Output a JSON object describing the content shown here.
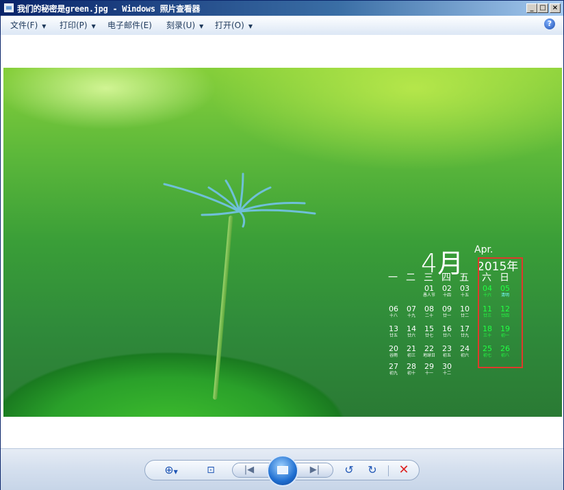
{
  "window": {
    "title": "我们的秘密是green.jpg - Windows 照片查看器",
    "min_label": "_",
    "max_label": "□",
    "close_label": "×"
  },
  "menu": {
    "items": [
      {
        "label": "文件(F)",
        "has_dropdown": true
      },
      {
        "label": "打印(P)",
        "has_dropdown": true
      },
      {
        "label": "电子邮件(E)",
        "has_dropdown": false
      },
      {
        "label": "刻录(U)",
        "has_dropdown": true
      },
      {
        "label": "打开(O)",
        "has_dropdown": true
      }
    ],
    "help_label": "?"
  },
  "photo_calendar": {
    "month": "4月",
    "month_en": "Apr.",
    "year": "2015年",
    "weekdays": [
      "一",
      "二",
      "三",
      "四",
      "五",
      "六",
      "日"
    ],
    "rows": [
      [
        null,
        null,
        {
          "n": "01",
          "l": "愚人节"
        },
        {
          "n": "02",
          "l": "十四"
        },
        {
          "n": "03",
          "l": "十五"
        },
        {
          "n": "04",
          "l": "十六"
        },
        {
          "n": "05",
          "l": "清明"
        }
      ],
      [
        {
          "n": "06",
          "l": "十八"
        },
        {
          "n": "07",
          "l": "十九"
        },
        {
          "n": "08",
          "l": "二十"
        },
        {
          "n": "09",
          "l": "廿一"
        },
        {
          "n": "10",
          "l": "廿二"
        },
        {
          "n": "11",
          "l": "廿三"
        },
        {
          "n": "12",
          "l": "廿四"
        }
      ],
      [
        {
          "n": "13",
          "l": "廿五"
        },
        {
          "n": "14",
          "l": "廿六"
        },
        {
          "n": "15",
          "l": "廿七"
        },
        {
          "n": "16",
          "l": "廿八"
        },
        {
          "n": "17",
          "l": "廿九"
        },
        {
          "n": "18",
          "l": "三十"
        },
        {
          "n": "19",
          "l": "初一"
        }
      ],
      [
        {
          "n": "20",
          "l": "谷雨"
        },
        {
          "n": "21",
          "l": "初三"
        },
        {
          "n": "22",
          "l": "地球日"
        },
        {
          "n": "23",
          "l": "初五"
        },
        {
          "n": "24",
          "l": "初六"
        },
        {
          "n": "25",
          "l": "初七"
        },
        {
          "n": "26",
          "l": "初八"
        }
      ],
      [
        {
          "n": "27",
          "l": "初九"
        },
        {
          "n": "28",
          "l": "初十"
        },
        {
          "n": "29",
          "l": "十一"
        },
        {
          "n": "30",
          "l": "十二"
        },
        null,
        null,
        null
      ]
    ]
  },
  "toolbar": {
    "zoom_icon": "zoom-magnifier-icon",
    "fit_icon": "actual-size-icon",
    "prev_icon": "previous-icon",
    "slideshow_icon": "slideshow-icon",
    "next_icon": "next-icon",
    "rotate_ccw_icon": "rotate-counterclockwise-icon",
    "rotate_cw_icon": "rotate-clockwise-icon",
    "delete_icon": "delete-icon"
  },
  "colors": {
    "highlight_box": "#e0392b",
    "weekend_text": "#22ff44"
  }
}
